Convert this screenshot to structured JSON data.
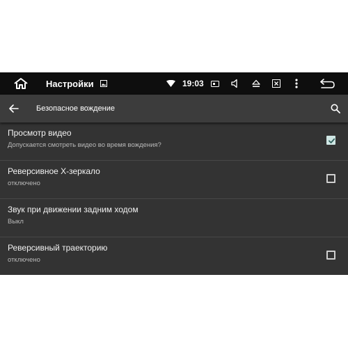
{
  "status_bar": {
    "app_title": "Настройки",
    "time": "19:03",
    "icons": [
      "home-icon",
      "image-icon",
      "wifi-icon",
      "screen-icon",
      "volume-icon",
      "eject-icon",
      "close-box-icon",
      "more-vert-icon",
      "back-arrow-icon"
    ]
  },
  "toolbar": {
    "title": "Безопасное вождение",
    "icons": [
      "back-arrow-icon",
      "search-icon"
    ]
  },
  "settings": [
    {
      "title": "Просмотр видео",
      "subtitle": "Допускается смотреть видео во время вождения?",
      "checkbox": true,
      "checked": true
    },
    {
      "title": "Реверсивное X-зеркало",
      "subtitle": "отключено",
      "checkbox": true,
      "checked": false
    },
    {
      "title": "Звук при движении задним ходом",
      "subtitle": "Выкл",
      "checkbox": false
    },
    {
      "title": "Реверсивный траекторию",
      "subtitle": "отключено",
      "checkbox": true,
      "checked": false
    }
  ],
  "colors": {
    "accent": "#cfe6e4",
    "background": "#333333",
    "status_bar": "#0e0e0e",
    "toolbar": "#3c3c3c"
  }
}
